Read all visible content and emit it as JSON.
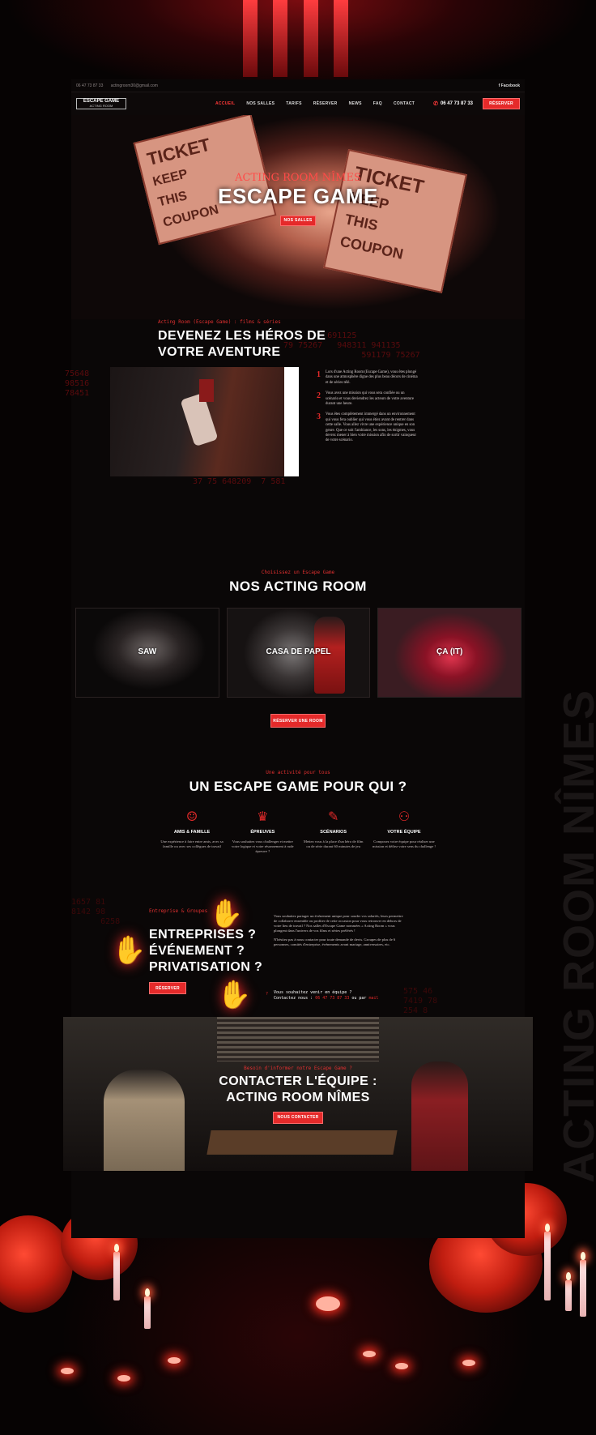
{
  "topbar": {
    "phone": "06 47 73 87 33",
    "email": "actingroom30@gmail.com",
    "facebook": "f  Facebook"
  },
  "nav": {
    "logo_main": "ESCAPE GAME",
    "logo_sub": "ACTING ROOM",
    "items": [
      "ACCUEIL",
      "NOS SALLES",
      "TARIFS",
      "RÉSERVER",
      "NEWS",
      "FAQ",
      "CONTACT"
    ],
    "active_index": 0,
    "phone": "06 47 73 87 33",
    "cta": "RÉSERVER"
  },
  "hero": {
    "subtitle": "ACTING ROOM NÎMES",
    "title": "ESCAPE GAME",
    "button": "NOS SALLES"
  },
  "intro": {
    "kicker": "Acting Room (Escape Game) : films & séries",
    "title_line1": "DEVENEZ LES HÉROS DE",
    "title_line2": "VOTRE AVENTURE",
    "steps": [
      {
        "n": "1",
        "text": "Lors d'une Acting Room (Escape Game), vous êtes plongé dans une atmosphère digne des plus beau décors de cinéma et de séries télé."
      },
      {
        "n": "2",
        "text": "Vous avez une mission qui vous sera confiée ou un scénario et vous deviendrez les acteurs de votre aventure durant une heure."
      },
      {
        "n": "3",
        "text": "Vous êtes complètement immergé dans un environnement qui vous fera oublier qui vous étiez avant de rentrer dans cette salle. Vous allez vivre une expérience unique en son genre. Que ce soit l'ambiance, les sons, les énigmes, vous devrez mener à bien votre mission afin de sortir vainqueur de votre scénario."
      }
    ]
  },
  "rooms_section": {
    "kicker": "Choisissez un Escape Game",
    "title": "NOS ACTING ROOM",
    "rooms": [
      "SAW",
      "CASA DE PAPEL",
      "ÇA (IT)"
    ],
    "button": "RÉSERVER UNE ROOM"
  },
  "audience": {
    "kicker": "Une activité pour tous",
    "title": "UN ESCAPE GAME POUR QUI ?",
    "cards": [
      {
        "icon": "friends-icon",
        "title": "AMIS & FAMILLE",
        "text": "Une expérience à faire entre amis, avec sa famille ou avec ses collègues de travail"
      },
      {
        "icon": "trophy-icon",
        "title": "ÉPREUVES",
        "text": "Vous souhaitez vous challenger et mettre votre logique et votre résonnement à rude épreuve ?"
      },
      {
        "icon": "film-icon",
        "title": "SCÉNARIOS",
        "text": "Mettez vous à la place d'un héro de film ou de série durant 60 minutes de jeu"
      },
      {
        "icon": "team-icon",
        "title": "VOTRE ÉQUIPE",
        "text": "Composez votre équipe pour réaliser une mission et défiez votre sens du challenge !"
      }
    ]
  },
  "business": {
    "kicker": "Entreprise & Groupes",
    "line1": "ENTREPRISES ?",
    "line2": "ÉVÉNEMENT ?",
    "line3": "PRIVATISATION ?",
    "button": "RÉSERVER",
    "desc1": "Vous souhaitez partager un événement unique pour souder vos salariés, leurs permettre de collaborer ensemble ou profiter de cette occasion pour vous retrouver en dehors de votre lieu de travail ? Nos salles d'Escape Game nommées « Acting Room » vous plongent dans l'univers de vos films et séries préférés !",
    "desc2": "N'hésitez pas à nous contacter pour toute demande de devis. Groupes de plus de 6 personnes, comités d'entreprise, événements avant mariage, anniversaires, etc.",
    "contact_line1": "Vous souhaitez venir en équipe ?",
    "contact_pre": "Contactez nous : ",
    "contact_phone": "06 47 73 87 33",
    "contact_mid": " ou par ",
    "contact_mail": "mail"
  },
  "contact_section": {
    "kicker": "Besoin d'informer notre Escape Game ?",
    "title_line1": "CONTACTER L'ÉQUIPE :",
    "title_line2": "ACTING ROOM NÎMES",
    "button": "NOUS CONTACTER"
  },
  "side_text": "ACTING ROOM NÎMES",
  "colors": {
    "accent": "#e52a2a",
    "background": "#0a0707"
  }
}
